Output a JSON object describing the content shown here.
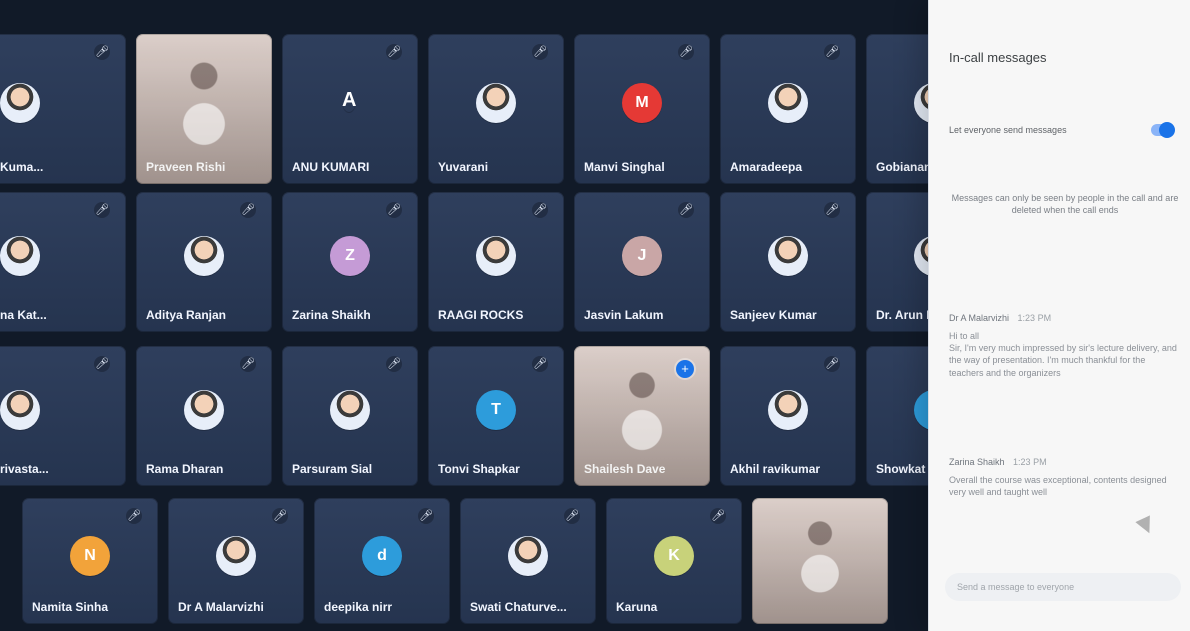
{
  "grid": {
    "tiles": [
      {
        "name": "Kuma...",
        "avatar_type": "partial",
        "avatar_letter": "",
        "accent": "#f3f6ff"
      },
      {
        "name": "Praveen Rishi",
        "avatar_type": "video",
        "avatar_letter": "",
        "accent": "#d4c7c2"
      },
      {
        "name": "ANU KUMARI",
        "avatar_type": "letter-big",
        "avatar_letter": "A",
        "accent": "#ffffff"
      },
      {
        "name": "Yuvarani",
        "avatar_type": "photo",
        "avatar_letter": "",
        "accent": "#f3f6ff"
      },
      {
        "name": "Manvi Singhal",
        "avatar_type": "letter",
        "avatar_letter": "M",
        "accent": "#e53935"
      },
      {
        "name": "Amaradeepa",
        "avatar_type": "photo",
        "avatar_letter": "",
        "accent": "#f3f6ff"
      },
      {
        "name": "Gobianand Kup...",
        "avatar_type": "photo",
        "avatar_letter": "",
        "accent": "#f3f6ff"
      },
      {
        "name": "na Kat...",
        "avatar_type": "partial",
        "avatar_letter": "",
        "accent": "#f3f6ff"
      },
      {
        "name": "Aditya Ranjan",
        "avatar_type": "photo",
        "avatar_letter": "",
        "accent": "#f3f6ff"
      },
      {
        "name": "Zarina Shaikh",
        "avatar_type": "letter",
        "avatar_letter": "Z",
        "accent": "#c59bd6"
      },
      {
        "name": "RAAGI ROCKS",
        "avatar_type": "photo",
        "avatar_letter": "",
        "accent": "#f3f6ff"
      },
      {
        "name": "Jasvin Lakum",
        "avatar_type": "letter",
        "avatar_letter": "J",
        "accent": "#c9a6a6"
      },
      {
        "name": "Sanjeev Kumar",
        "avatar_type": "photo",
        "avatar_letter": "",
        "accent": "#f3f6ff"
      },
      {
        "name": "Dr. Arun Kumar",
        "avatar_type": "photo",
        "avatar_letter": "",
        "accent": "#f3f6ff"
      },
      {
        "name": "rivasta...",
        "avatar_type": "partial",
        "avatar_letter": "",
        "accent": "#f3f6ff"
      },
      {
        "name": "Rama Dharan",
        "avatar_type": "photo",
        "avatar_letter": "",
        "accent": "#f3f6ff"
      },
      {
        "name": "Parsuram Sial",
        "avatar_type": "photo",
        "avatar_letter": "",
        "accent": "#f3f6ff"
      },
      {
        "name": "Tonvi Shapkar",
        "avatar_type": "letter",
        "avatar_letter": "T",
        "accent": "#2d9cdb"
      },
      {
        "name": "Shailesh Dave",
        "avatar_type": "video-pinned",
        "avatar_letter": "",
        "accent": "#d4c7c2"
      },
      {
        "name": "Akhil ravikumar",
        "avatar_type": "photo",
        "avatar_letter": "",
        "accent": "#f3f6ff"
      },
      {
        "name": "Showkat Ahma...",
        "avatar_type": "letter",
        "avatar_letter": "S",
        "accent": "#2d9cdb"
      },
      {
        "name": "Namita Sinha",
        "avatar_type": "letter",
        "avatar_letter": "N",
        "accent": "#f2a33a"
      },
      {
        "name": "Dr A Malarvizhi",
        "avatar_type": "photo",
        "avatar_letter": "",
        "accent": "#f3f6ff"
      },
      {
        "name": "deepika nirr",
        "avatar_type": "letter",
        "avatar_letter": "d",
        "accent": "#2d9cdb"
      },
      {
        "name": "Swati Chaturve...",
        "avatar_type": "photo",
        "avatar_letter": "",
        "accent": "#f3f6ff"
      },
      {
        "name": "Karuna",
        "avatar_type": "letter",
        "avatar_letter": "K",
        "accent": "#c8d27a"
      },
      {
        "name": "",
        "avatar_type": "video",
        "avatar_letter": "",
        "accent": "#d4c7c2"
      }
    ]
  },
  "panel": {
    "title": "In-call messages",
    "toggle_label": "Let everyone send messages",
    "notice": "Messages can only be seen by people in the call and are deleted when the call ends",
    "messages": [
      {
        "who": "Dr A Malarvizhi",
        "time": "1:23 PM",
        "text": "Hi to all\nSir, I'm very much impressed by sir's lecture delivery, and the way of presentation. I'm much thankful for the teachers and the organizers"
      },
      {
        "who": "Zarina Shaikh",
        "time": "1:23 PM",
        "text": "Overall the course was exceptional, contents designed very well and taught well"
      }
    ],
    "input_placeholder": "Send a message to everyone"
  }
}
